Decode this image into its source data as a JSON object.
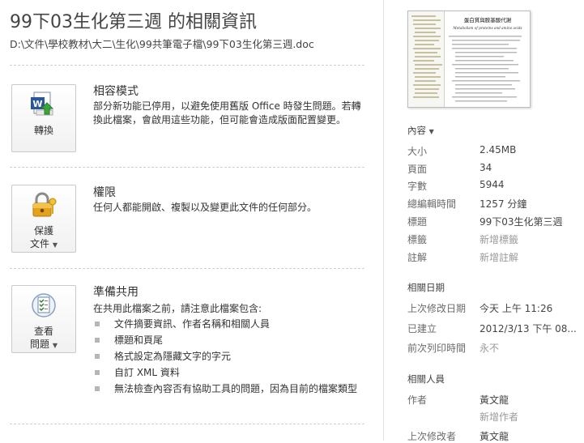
{
  "header": {
    "title": "99下03生化第三週 的相關資訊",
    "path": "D:\\文件\\學校教材\\大二\\生化\\99共筆電子檔\\99下03生化第三週.doc"
  },
  "sections": {
    "compat": {
      "button_label": "轉換",
      "title": "相容模式",
      "body": "部分新功能已停用，以避免使用舊版 Office 時發生問題。若轉換此檔案，會啟用這些功能，但可能會造成版面配置變更。"
    },
    "permissions": {
      "button_label_1": "保護",
      "button_label_2": "文件",
      "title": "權限",
      "body": "任何人都能開啟、複製以及變更此文件的任何部分。"
    },
    "share": {
      "button_label_1": "查看",
      "button_label_2": "問題",
      "title": "準備共用",
      "intro": "在共用此檔案之前，請注意此檔案包含:",
      "items": [
        "文件摘要資訊、作者名稱和相關人員",
        "標題和頁尾",
        "格式設定為隱藏文字的字元",
        "自訂 XML 資料",
        "無法檢查內容否有協助工具的問題，因為目前的檔案類型"
      ]
    }
  },
  "thumbnail": {
    "heading": "蛋白質與胺基酸代謝",
    "subheading": "Metabolism of proteins and amino acids"
  },
  "properties": {
    "heading": "內容",
    "rows": [
      {
        "label": "大小",
        "value": "2.45MB"
      },
      {
        "label": "頁面",
        "value": "34"
      },
      {
        "label": "字數",
        "value": "5944"
      },
      {
        "label": "總編輯時間",
        "value": "1257 分鐘"
      },
      {
        "label": "標題",
        "value": "99下03生化第三週"
      },
      {
        "label": "標籤",
        "value": "新增標籤"
      },
      {
        "label": "註解",
        "value": "新增註解"
      }
    ]
  },
  "dates": {
    "heading": "相關日期",
    "rows": [
      {
        "label": "上次修改日期",
        "value": "今天 上午 11:26"
      },
      {
        "label": "已建立",
        "value": "2012/3/13 下午 08..."
      },
      {
        "label": "前次列印時間",
        "value": "永不"
      }
    ]
  },
  "people": {
    "heading": "相關人員",
    "author_label": "作者",
    "author_value": "黃文龍",
    "add_author": "新增作者",
    "modified_label": "上次修改者",
    "modified_value": "黃文龍"
  },
  "colors": {
    "accent": "#2b579a",
    "muted": "#9a9a9a",
    "separator": "#cfcfcf"
  }
}
